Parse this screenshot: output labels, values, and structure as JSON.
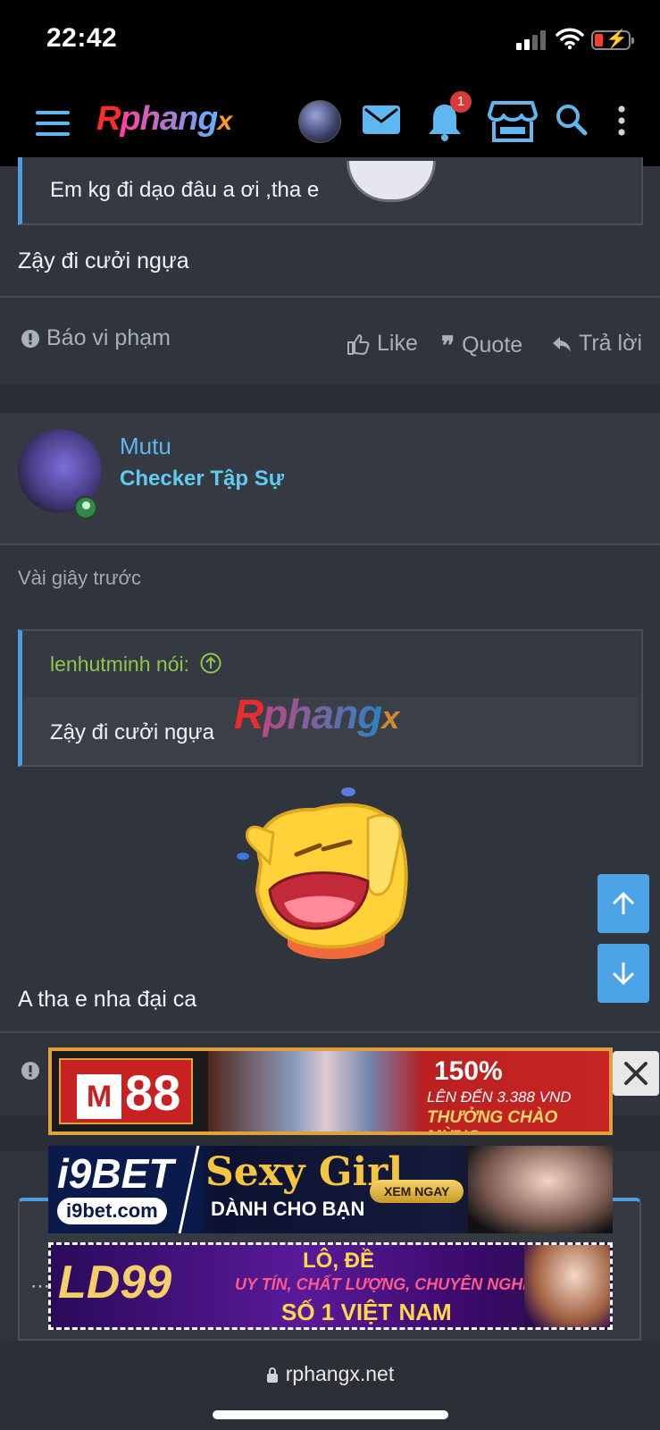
{
  "status_bar": {
    "time": "22:42"
  },
  "nav": {
    "logo": {
      "r": "R",
      "mid": "phang",
      "x": "x"
    },
    "notification_count": "1"
  },
  "post1": {
    "quote_text": "Em kg đi dạo đâu a ơi ,tha e",
    "reply_text": "Zậy đi cưởi ngựa",
    "report_label": "Báo vi phạm",
    "like_label": "Like",
    "quote_label": "Quote",
    "reply_label": "Trả lời"
  },
  "post2": {
    "username": "Mutu",
    "user_title": "Checker Tập Sự",
    "timestamp": "Vài giây trước",
    "quote_author": "lenhutminh nói:",
    "quote_text": "Zậy đi cưởi ngựa",
    "body_text": "A tha e nha đại ca"
  },
  "watermark": {
    "r": "R",
    "mid": "phang",
    "x": "x"
  },
  "ads": {
    "m88": {
      "logo": "88",
      "percent": "150%",
      "upto": "LÊN ĐẾN 3.388 VND",
      "welcome": "THƯỞNG CHÀO MỪNG"
    },
    "i9bet": {
      "brand": "i9BET",
      "domain": "i9bet.com",
      "headline": "Sexy Girl",
      "sub": "DÀNH CHO BẠN",
      "cta": "XEM NGAY"
    },
    "ld99": {
      "brand": "LD99",
      "line1": "LÔ, ĐỀ",
      "line2": "UY TÍN, CHẤT LƯỢNG, CHUYÊN NGHIỆP",
      "line3": "SỐ 1 VIỆT NAM"
    }
  },
  "browser": {
    "url": "rphangx.net"
  },
  "colors": {
    "accent": "#4ca3e6",
    "username": "#5fb7f0",
    "quote_author": "#8dc74d",
    "badge": "#d83a3a"
  }
}
